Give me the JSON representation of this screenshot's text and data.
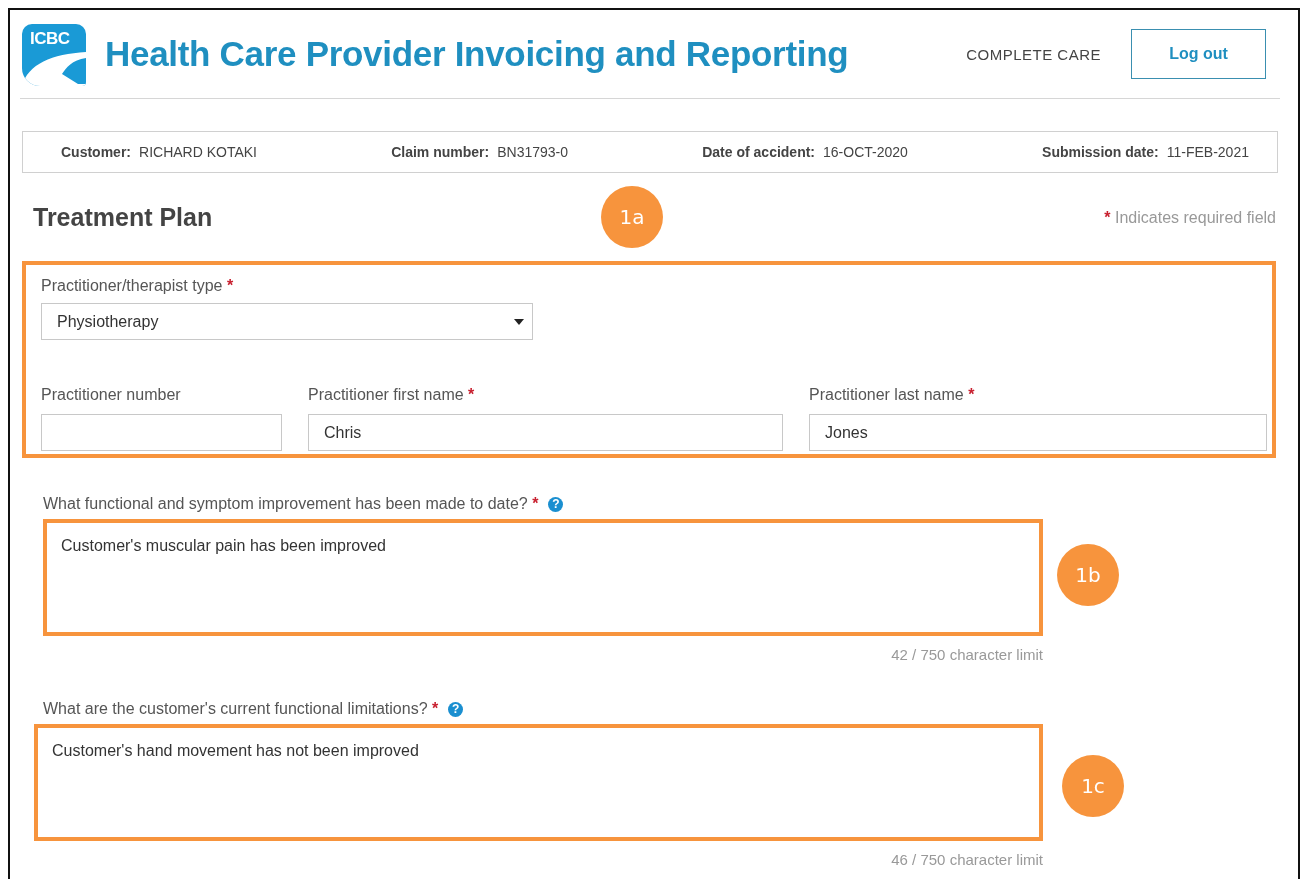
{
  "header": {
    "logo_text": "ICBC",
    "title": "Health Care Provider Invoicing and Reporting",
    "account": "COMPLETE CARE",
    "logout_button": "Log out"
  },
  "claim_info": [
    {
      "label": "Customer:",
      "value": "RICHARD KOTAKI"
    },
    {
      "label": "Claim number:",
      "value": "BN31793-0"
    },
    {
      "label": "Date of accident:",
      "value": "16-OCT-2020"
    },
    {
      "label": "Submission date:",
      "value": "11-FEB-2021"
    }
  ],
  "page_title": "Treatment Plan",
  "required_note": {
    "mark": "*",
    "text": "Indicates required field"
  },
  "practitioner_section": {
    "annotation": "1a",
    "type_field": {
      "label": "Practitioner/therapist type",
      "required_mark": "*",
      "value": "Physiotherapy"
    },
    "name_fields": [
      {
        "label": "Practitioner number"
      },
      {
        "label": "Practitioner first name",
        "required_mark": "*",
        "value": "Chris"
      },
      {
        "label": "Practitioner last name",
        "required_mark": "*",
        "value": "Jones"
      }
    ]
  },
  "questions": [
    {
      "label": "What functional and symptom improvement has been made to date?",
      "required_mark": "*",
      "help": "?",
      "value": "Customer's muscular pain has been improved",
      "counter": "42 / 750 character limit",
      "annotation": "1b"
    },
    {
      "label": "What are the customer's current functional limitations?",
      "required_mark": "*",
      "help": "?",
      "value": "Customer's hand movement has not been improved",
      "counter": "46 / 750 character limit",
      "annotation": "1c"
    }
  ]
}
